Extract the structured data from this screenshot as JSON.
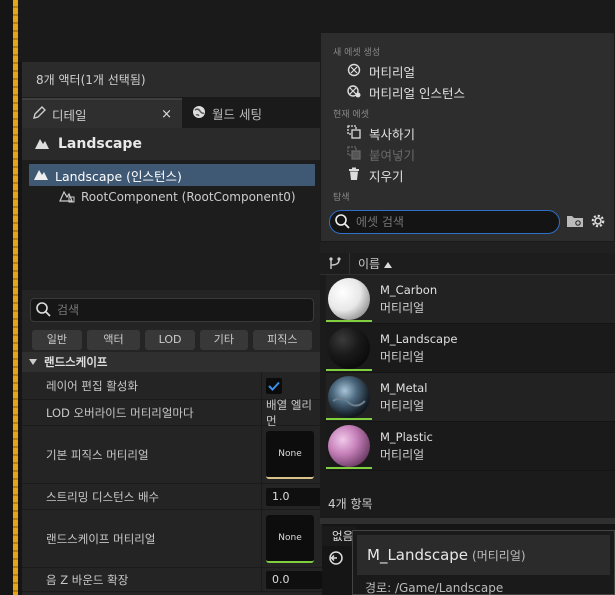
{
  "details": {
    "actor_count": "8개 액터(1개 선택됨)",
    "tabs": [
      {
        "label": "디테일",
        "close": "×"
      },
      {
        "label": "월드 세팅"
      }
    ],
    "title": "Landscape",
    "tree": {
      "selected": "Landscape (인스턴스)",
      "child": "RootComponent (RootComponent0)"
    },
    "search_placeholder": "검색",
    "filters": [
      "일반",
      "액터",
      "LOD",
      "기타",
      "피직스"
    ],
    "section": "랜드스케이프",
    "props": {
      "layer_edit": "레이어 편집 활성화",
      "lod_override": "LOD 오버라이드 머티리얼마다",
      "lod_override_value": "배열 엘리먼",
      "phys_material": "기본 피직스 머티리얼",
      "phys_material_value": "None",
      "streaming": "스트리밍 디스턴스 배수",
      "streaming_value": "1.0",
      "landscape_material": "랜드스케이프 머티리얼",
      "landscape_material_value": "None",
      "neg_z": "음 Z 바운드 확장",
      "neg_z_value": "0.0"
    }
  },
  "menu": {
    "head_create": "새 에셋 생성",
    "create_items": [
      "머티리얼",
      "머티리얼 인스턴스"
    ],
    "head_current": "현재 에셋",
    "current_items": [
      {
        "label": "복사하기",
        "disabled": false
      },
      {
        "label": "붙여넣기",
        "disabled": true
      },
      {
        "label": "지우기",
        "disabled": false
      }
    ],
    "head_browse": "탐색",
    "search_placeholder": "에셋 검색"
  },
  "assets": {
    "column_name": "이름",
    "items": [
      {
        "name": "M_Carbon",
        "type": "머티리얼"
      },
      {
        "name": "M_Landscape",
        "type": "머티리얼"
      },
      {
        "name": "M_Metal",
        "type": "머티리얼"
      },
      {
        "name": "M_Plastic",
        "type": "머티리얼"
      }
    ],
    "count": "4개 항목"
  },
  "dropdown": "없음",
  "tooltip": {
    "title": "M_Landscape",
    "type": "(머티리얼)",
    "path": "경로: /Game/Landscape"
  },
  "colors": {
    "accent_blue": "#2f6fc7",
    "selection": "#3f5874",
    "green_bar": "#7fcf3f",
    "orange_strip": "#e8a316"
  }
}
